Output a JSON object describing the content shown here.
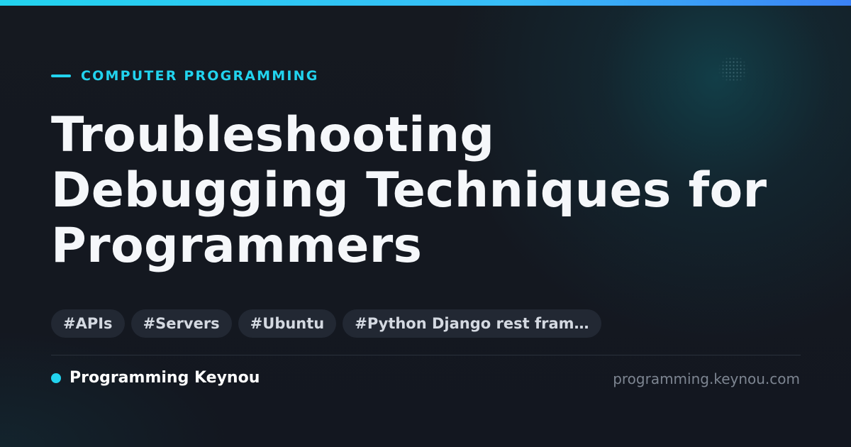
{
  "category": "COMPUTER PROGRAMMING",
  "title_lines": [
    "Troubleshooting",
    "Debugging Techniques for",
    "Programmers"
  ],
  "tags": [
    "#APIs",
    "#Servers",
    "#Ubuntu",
    "#Python Django rest fram…"
  ],
  "footer": {
    "brand": "Programming Keynou",
    "url": "programming.keynou.com"
  },
  "colors": {
    "accent": "#22d3ee",
    "background": "#141820",
    "tag_background": "#222833",
    "title": "#f5f7fa"
  }
}
